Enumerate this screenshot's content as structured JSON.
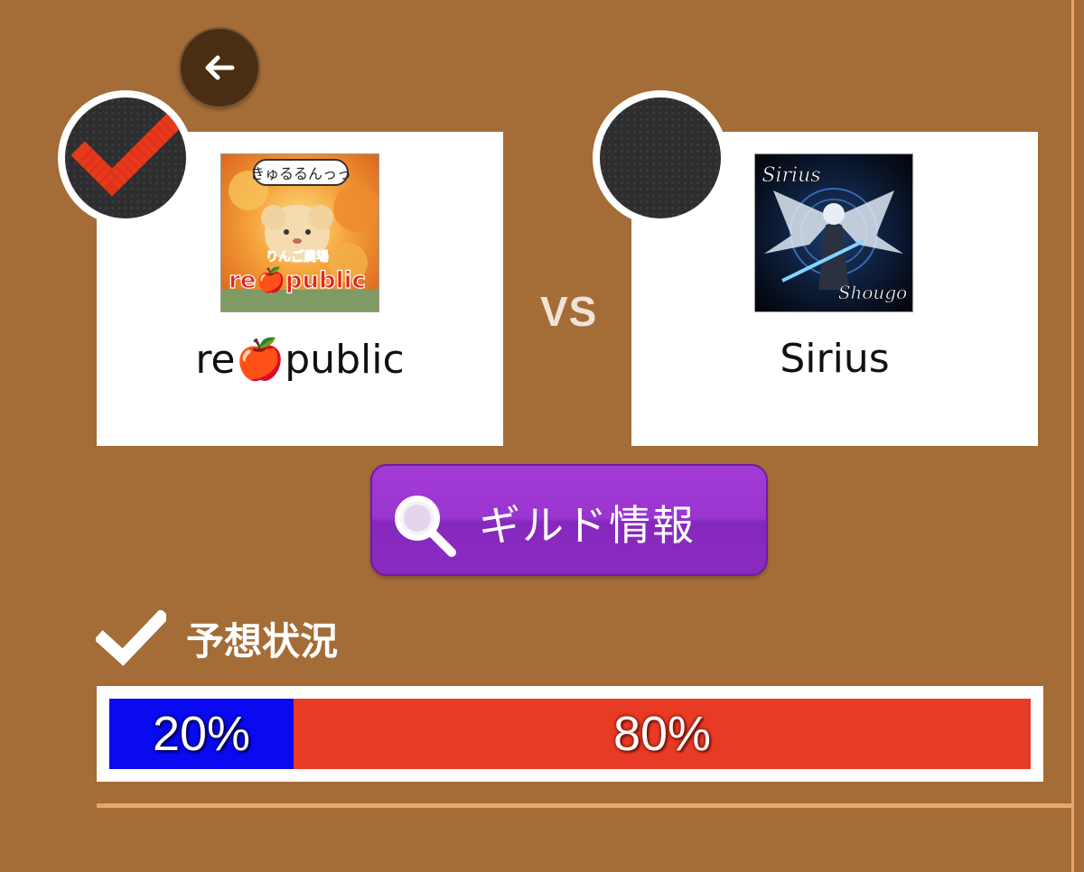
{
  "left_guild": {
    "name": "republic",
    "name_display": "re🍎public",
    "selected": true,
    "image_text_top": "きゅるるんっっ",
    "image_text_sub": "りんご農場",
    "image_text_main": "re🍎public"
  },
  "right_guild": {
    "name": "Sirius",
    "selected": false,
    "image_text_top": "Sirius",
    "image_text_bottom": "Shougo"
  },
  "vs_label": "VS",
  "guild_info_button": {
    "label": "ギルド情報",
    "icon": "search-icon"
  },
  "prediction": {
    "title": "予想状況",
    "left_percent_label": "20%",
    "right_percent_label": "80%",
    "left_fraction": 0.2,
    "right_fraction": 0.8
  },
  "colors": {
    "background": "#a46c36",
    "button_purple": "#9a35cf",
    "bar_blue": "#0a0af0",
    "bar_red": "#e83b26",
    "check_red": "#e8391d"
  }
}
